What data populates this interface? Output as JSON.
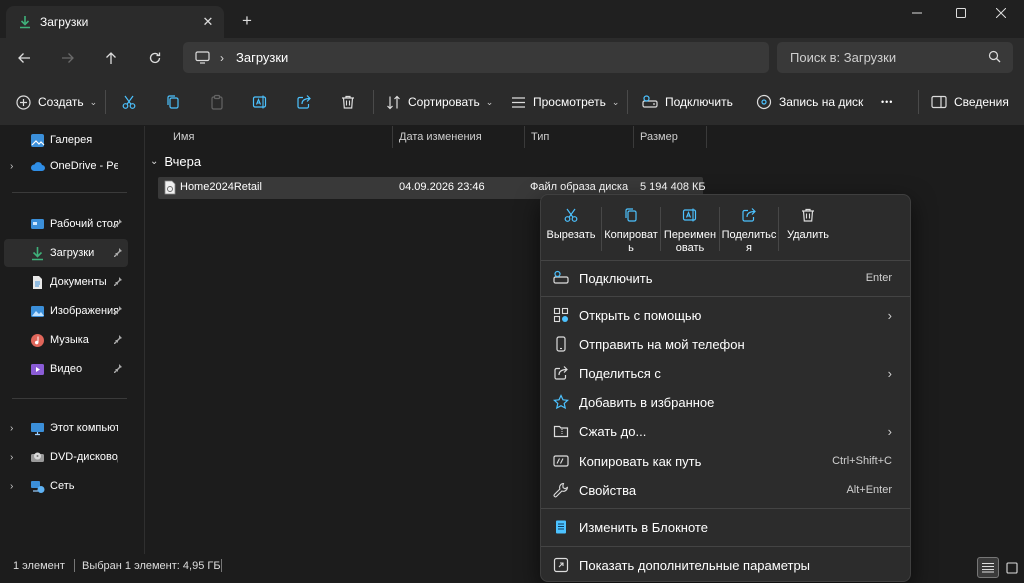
{
  "window": {
    "tab_title": "Загрузки",
    "close_tab_glyph": "✕",
    "new_tab_glyph": "+"
  },
  "address": {
    "breadcrumb": "Загрузки",
    "separator": "›",
    "search_placeholder": "Поиск в: Загрузки"
  },
  "toolbar": {
    "create_label": "Создать",
    "sort_label": "Сортировать",
    "view_label": "Просмотреть",
    "connect_label": "Подключить",
    "burn_label": "Запись на диск",
    "more_glyph": "•••",
    "details_label": "Сведения",
    "chevron": "⌄"
  },
  "sidebar": {
    "items": [
      {
        "label": "Галерея"
      },
      {
        "label": "OneDrive - Personal"
      },
      {
        "label": "Рабочий стол"
      },
      {
        "label": "Загрузки"
      },
      {
        "label": "Документы"
      },
      {
        "label": "Изображения"
      },
      {
        "label": "Музыка"
      },
      {
        "label": "Видео"
      },
      {
        "label": "Этот компьютер"
      },
      {
        "label": "DVD-дисковод (E:)"
      },
      {
        "label": "Сеть"
      }
    ],
    "expander": "›"
  },
  "filelist": {
    "columns": [
      "Имя",
      "Дата изменения",
      "Тип",
      "Размер"
    ],
    "group_label": "Вчера",
    "group_chevron": "⌄",
    "rows": [
      {
        "name": "Home2024Retail",
        "date": "04.09.2026 23:46",
        "type": "Файл образа диска",
        "size": "5 194 408 КБ"
      }
    ]
  },
  "status": {
    "count": "1 элемент",
    "selected": "Выбран 1 элемент: 4,95 ГБ"
  },
  "context_menu": {
    "quick_actions": [
      {
        "label": "Вырезать"
      },
      {
        "label": "Копироват ь"
      },
      {
        "label": "Переимен овать"
      },
      {
        "label": "Поделитьс я"
      },
      {
        "label": "Удалить"
      }
    ],
    "items": [
      {
        "label": "Подключить",
        "accel": "Enter"
      },
      {
        "label": "Открыть с помощью",
        "accel": "›"
      },
      {
        "label": "Отправить на мой телефон",
        "accel": ""
      },
      {
        "label": "Поделиться с",
        "accel": "›"
      },
      {
        "label": "Добавить в избранное",
        "accel": ""
      },
      {
        "label": "Сжать до...",
        "accel": "›"
      },
      {
        "label": "Копировать как путь",
        "accel": "Ctrl+Shift+C"
      },
      {
        "label": "Свойства",
        "accel": "Alt+Enter"
      },
      {
        "label": "Изменить в Блокноте",
        "accel": ""
      },
      {
        "label": "Показать дополнительные параметры",
        "accel": ""
      }
    ]
  },
  "colors": {
    "accent": "#4cc2ff",
    "download_green": "#3fb17a",
    "menu_bg": "#2c2c2c",
    "selection": "#393939"
  }
}
